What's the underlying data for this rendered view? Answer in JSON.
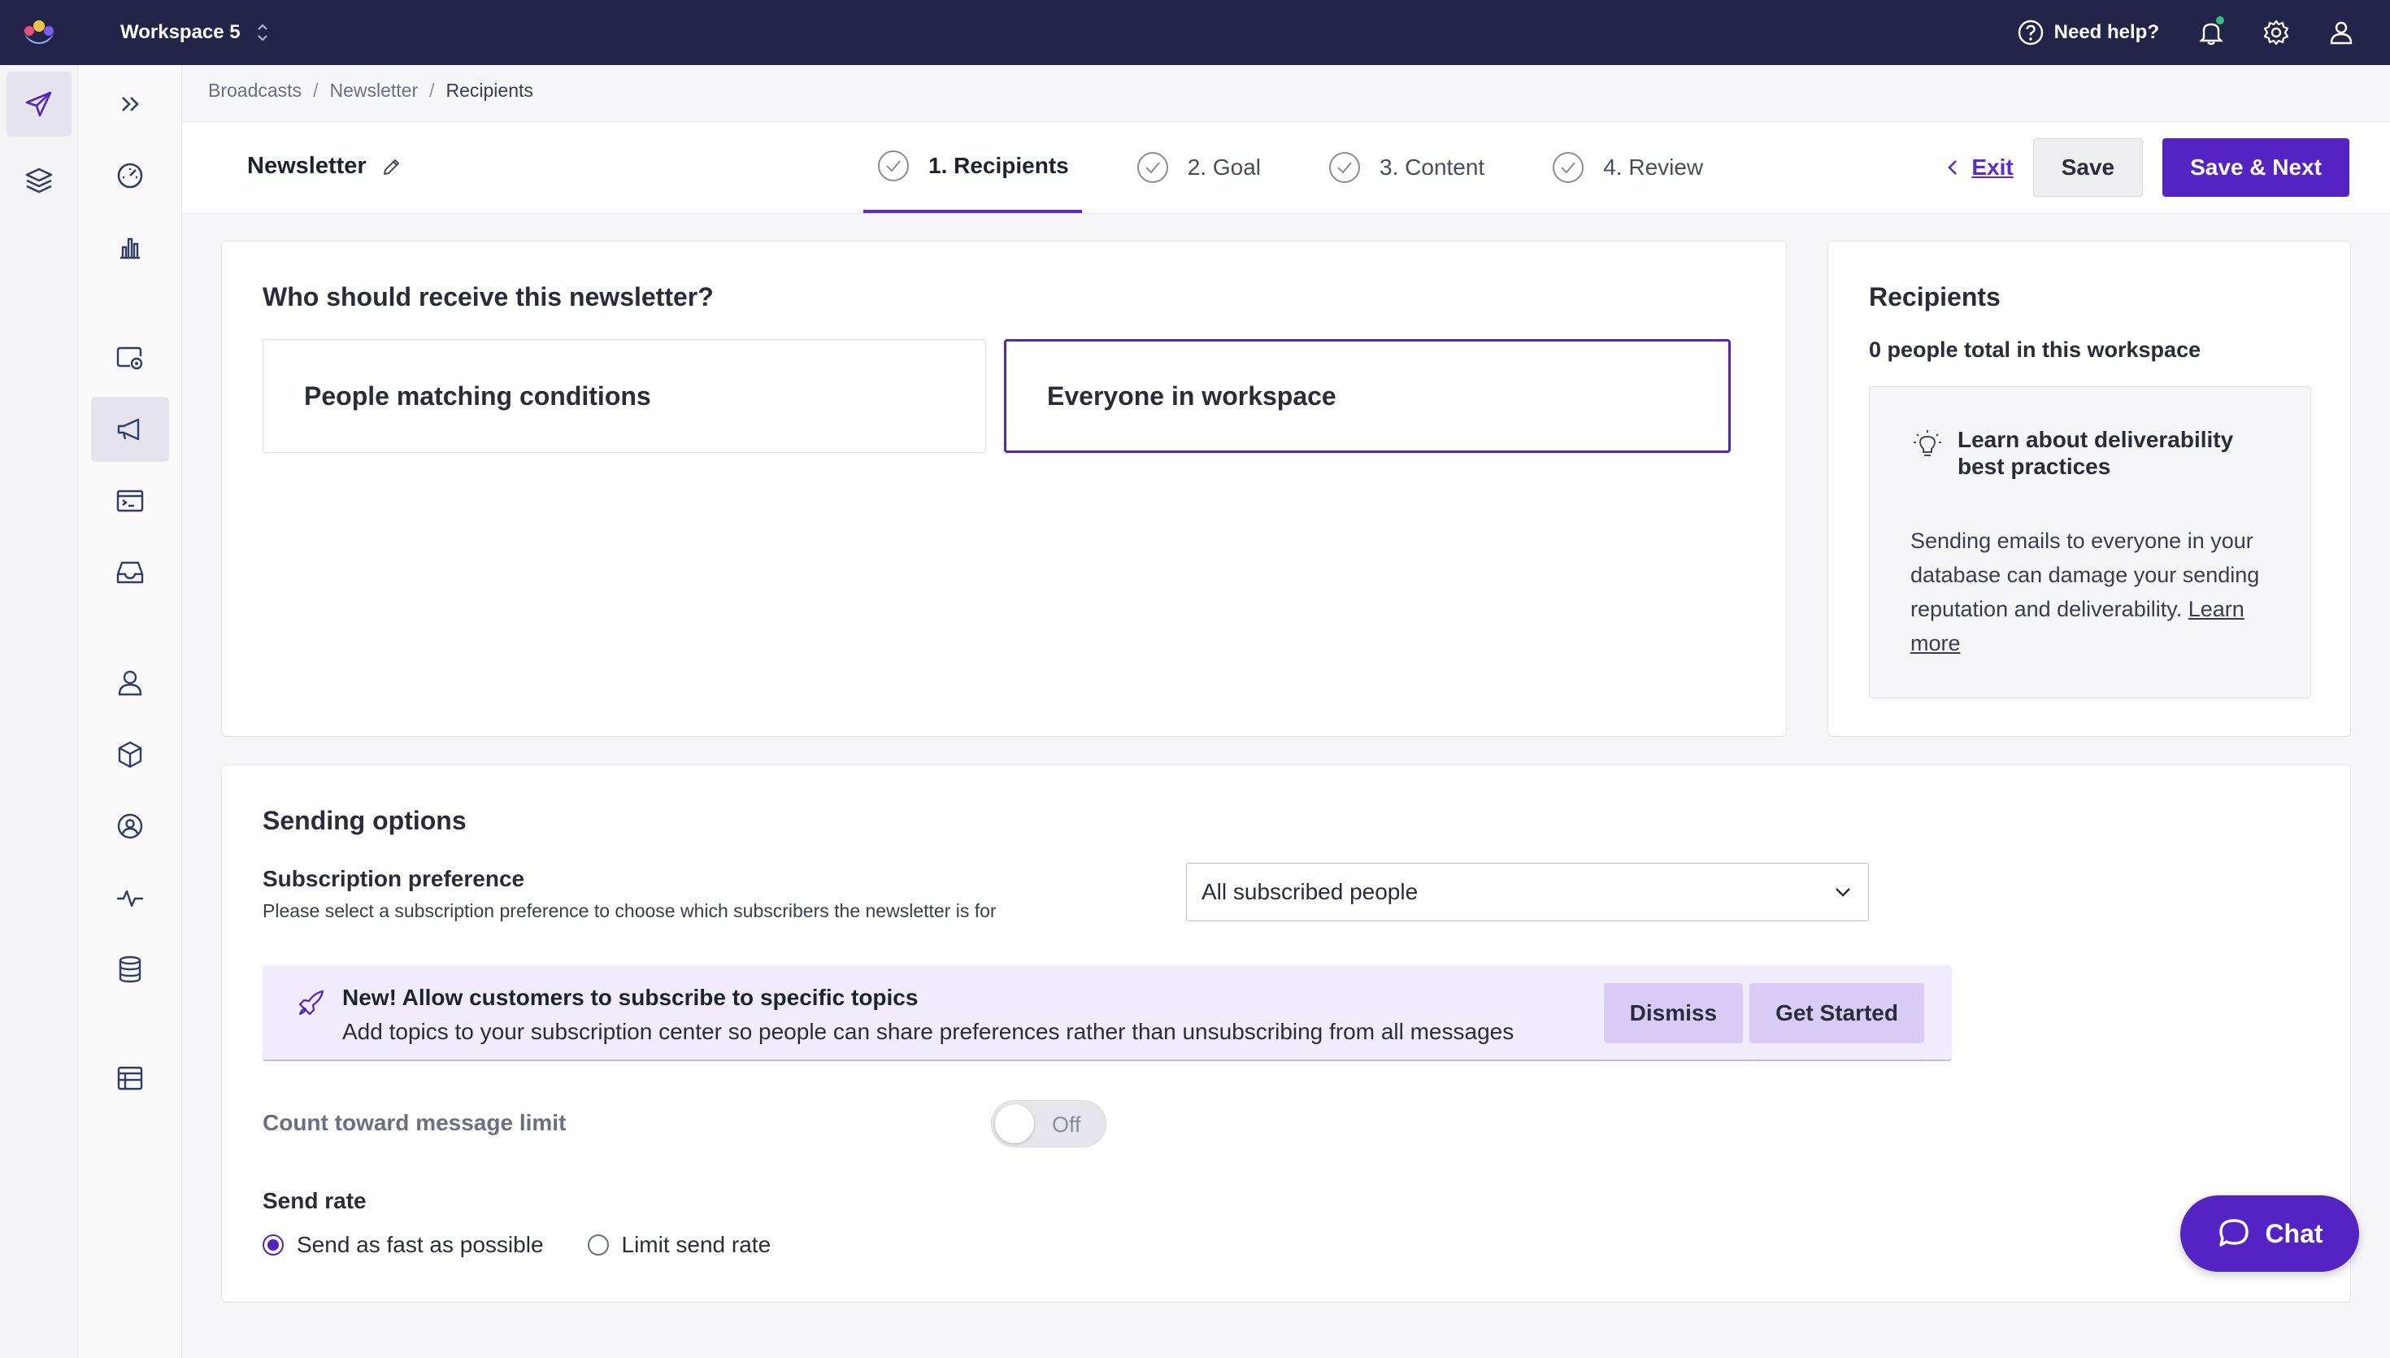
{
  "topbar": {
    "workspace": "Workspace 5",
    "help": "Need help?"
  },
  "breadcrumb": [
    "Broadcasts",
    "Newsletter",
    "Recipients"
  ],
  "header": {
    "title": "Newsletter",
    "steps": [
      "1. Recipients",
      "2. Goal",
      "3. Content",
      "4. Review"
    ],
    "exit": "Exit",
    "save": "Save",
    "save_next": "Save & Next"
  },
  "recipients_card": {
    "question": "Who should receive this newsletter?",
    "option_conditions": "People matching conditions",
    "option_everyone": "Everyone in workspace",
    "selected": "Everyone in workspace"
  },
  "side_card": {
    "title": "Recipients",
    "count": "0 people total in this workspace",
    "tip_title": "Learn about deliverability best practices",
    "tip_body": "Sending emails to everyone in your database can damage your sending reputation and deliverability.",
    "tip_link": "Learn more"
  },
  "sending": {
    "title": "Sending options",
    "sub_label": "Subscription preference",
    "sub_help": "Please select a subscription preference to choose which subscribers the newsletter is for",
    "sub_value": "All subscribed people",
    "banner_title": "New! Allow customers to subscribe to specific topics",
    "banner_text": "Add topics to your subscription center so people can share preferences rather than unsubscribing from all messages",
    "dismiss": "Dismiss",
    "get_started": "Get Started",
    "count_label": "Count toward message limit",
    "toggle_state": "Off",
    "rate_label": "Send rate",
    "rate_fast": "Send as fast as possible",
    "rate_limit": "Limit send rate"
  },
  "chat": "Chat",
  "colors": {
    "topbar": "#23244a",
    "accent": "#5423c4",
    "banner": "#f1ecfc"
  }
}
